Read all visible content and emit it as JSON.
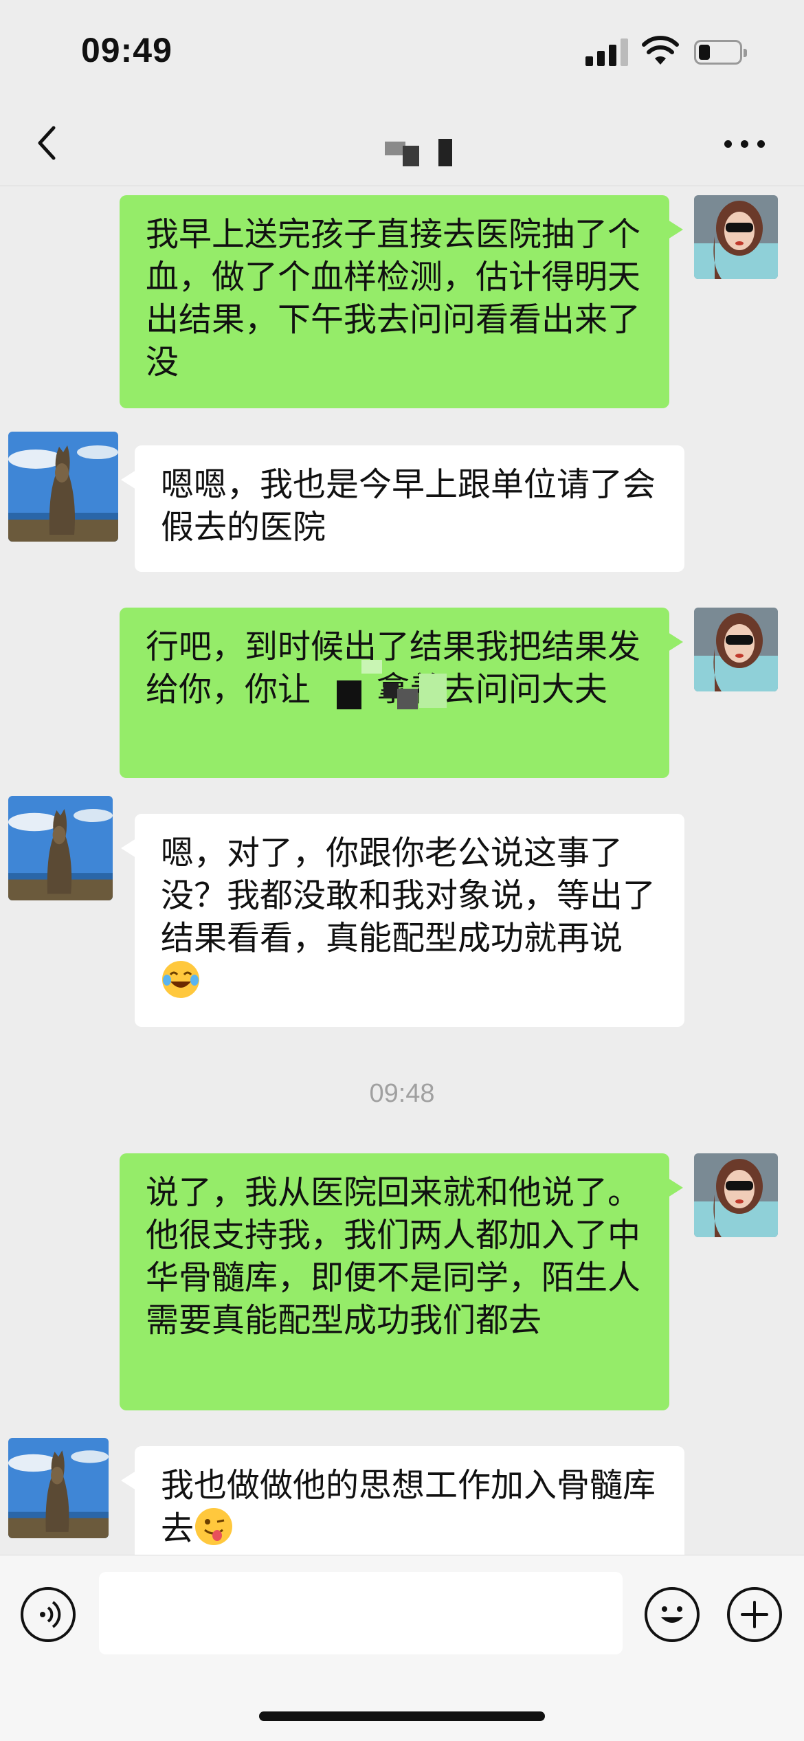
{
  "status_bar": {
    "time": "09:49"
  },
  "nav": {
    "title": ""
  },
  "messages": [
    {
      "side": "me",
      "text": "我早上送完孩子直接去医院抽了个血，做了个血样检测，估计得明天出结果，下午我去问问看看出来了没"
    },
    {
      "side": "them",
      "text": "嗯嗯，我也是今早上跟单位请了会假去的医院"
    },
    {
      "side": "me",
      "text": "行吧，到时候出了结果我把结果发给你，你让　　拿着去问问大夫"
    },
    {
      "side": "them",
      "text": "嗯，对了，你跟你老公说这事了没？我都没敢和我对象说，等出了结果看看，真能配型成功就再说",
      "emoji": "laughing-tears"
    },
    {
      "side": "me",
      "text": "说了，我从医院回来就和他说了。他很支持我，我们两人都加入了中华骨髓库，即便不是同学，陌生人需要真能配型成功我们都去"
    },
    {
      "side": "them",
      "text": "我也做做他的思想工作加入骨髓库去",
      "emoji": "winking-tongue"
    }
  ],
  "time_separator": "09:48",
  "input": {
    "placeholder": "",
    "value": ""
  },
  "colors": {
    "my_bubble": "#95ec69",
    "their_bubble": "#ffffff",
    "background": "#ededed"
  }
}
